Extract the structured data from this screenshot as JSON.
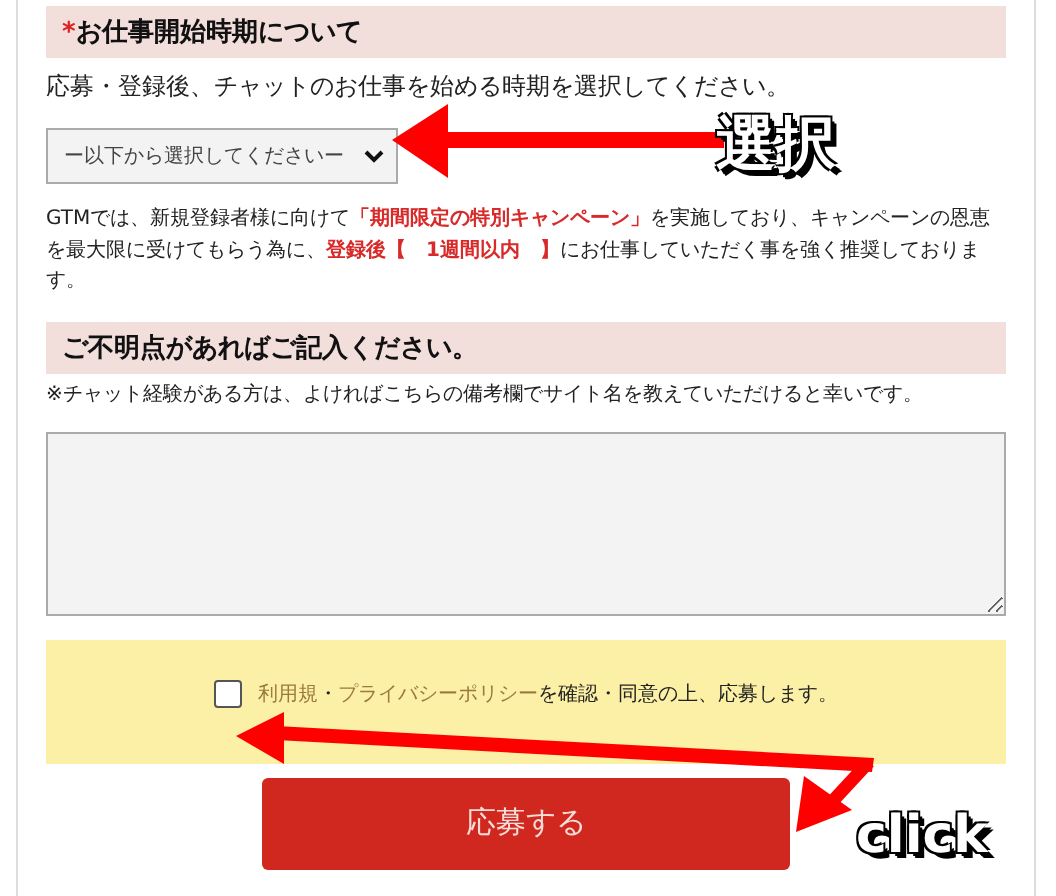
{
  "start_period": {
    "title": "お仕事開始時期について",
    "required": true,
    "required_mark": "*",
    "description": "応募・登録後、チャットのお仕事を始める時期を選択してください。",
    "select": {
      "value": "ー以下から選択してくださいー"
    },
    "note": [
      {
        "text": "GTMでは、新規登録者様に向けて",
        "emphasis": false
      },
      {
        "text": "「期間限定の特別キャンペーン」",
        "emphasis": true
      },
      {
        "text": "を実施しており、キャンペーンの恩恵を最大限に受けてもらう為に、",
        "emphasis": false
      },
      {
        "text": "登録後【　1週間以内　】",
        "emphasis": true
      },
      {
        "text": "にお仕事していただく事を強く推奨しております。",
        "emphasis": false
      }
    ]
  },
  "remarks": {
    "title": "ご不明点があればご記入ください。",
    "required": false,
    "note": "※チャット経験がある方は、よければこちらの備考欄でサイト名を教えていただけると幸いです。"
  },
  "consent": {
    "checked": false,
    "terms_link": "利用規",
    "separator": "・",
    "privacy_link": "プライバシーポリシー",
    "text": "を確認・同意の上、応募します。"
  },
  "submit_button": "応募する",
  "annotations": [
    {
      "kind": "select-arrow",
      "text": "選択"
    },
    {
      "kind": "click-arrow",
      "text": "click"
    }
  ]
}
